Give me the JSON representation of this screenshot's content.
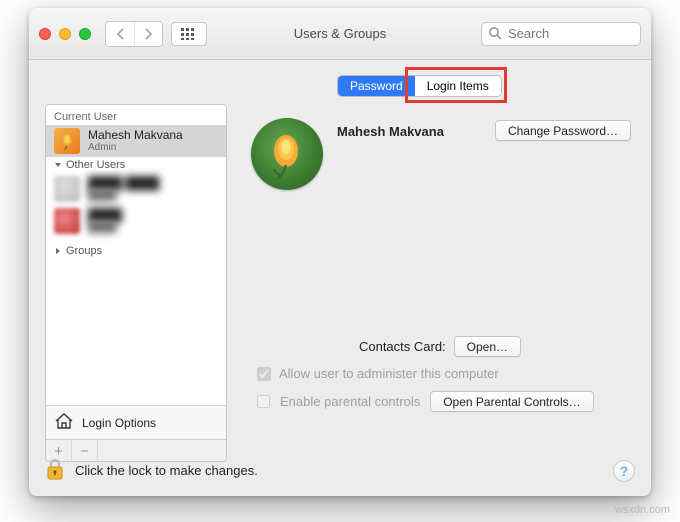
{
  "window": {
    "title": "Users & Groups",
    "search_placeholder": "Search"
  },
  "tabs": {
    "password": "Password",
    "login_items": "Login Items",
    "active": "password"
  },
  "sidebar": {
    "current_user_label": "Current User",
    "current_user": {
      "name": "Mahesh Makvana",
      "role": "Admin"
    },
    "other_users_label": "Other Users",
    "groups_label": "Groups",
    "login_options_label": "Login Options"
  },
  "detail": {
    "user_name": "Mahesh Makvana",
    "change_password_btn": "Change Password…",
    "contacts_label": "Contacts Card:",
    "open_btn": "Open…",
    "admin_checkbox_label": "Allow user to administer this computer",
    "parental_checkbox_label": "Enable parental controls",
    "open_parental_btn": "Open Parental Controls…"
  },
  "footer": {
    "lock_text": "Click the lock to make changes.",
    "help_label": "?"
  },
  "watermark": "wsxdn.com"
}
